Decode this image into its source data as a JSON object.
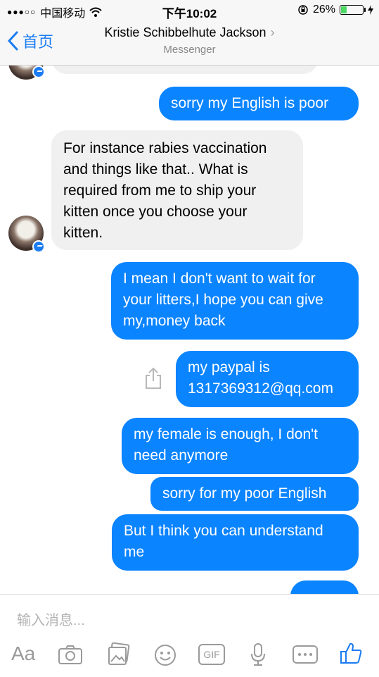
{
  "statusbar": {
    "signal_dots": "●●●○○",
    "carrier": "中国移动",
    "time": "下午10:02",
    "battery_pct": "26%",
    "battery_level": 0.26
  },
  "navbar": {
    "back_label": "首页",
    "title": "Kristie Schibbelhute Jackson",
    "subtitle": "Messenger"
  },
  "messages": [
    {
      "side": "in",
      "text": ""
    },
    {
      "side": "out",
      "text": "sorry my English is poor"
    },
    {
      "side": "in",
      "lines": [
        "For instance rabies vaccination",
        "and things like that.. What is",
        "required from me to ship your",
        "kitten once you choose your",
        "kitten."
      ]
    },
    {
      "side": "out",
      "lines": [
        "I mean I don't want to wait for",
        "your litters,I hope you can give",
        "my,money back"
      ]
    },
    {
      "side": "out",
      "lines": [
        "my paypal is",
        "1317369312@qq.com"
      ]
    },
    {
      "side": "out",
      "lines": [
        "my female is enough,  I don't",
        "need anymore"
      ]
    },
    {
      "side": "out",
      "text": "sorry for my poor English"
    },
    {
      "side": "out",
      "lines": [
        "But I think you can understand",
        "me"
      ]
    },
    {
      "side": "out",
      "text": ""
    }
  ],
  "composer": {
    "placeholder": "输入消息...",
    "tools": [
      "Aa",
      "camera-icon",
      "photo-icon",
      "emoji-icon",
      "GIF",
      "microphone-icon",
      "more-icon",
      "like-icon"
    ]
  },
  "colors": {
    "accent": "#0b84ff",
    "incoming": "#f1f0f0"
  }
}
